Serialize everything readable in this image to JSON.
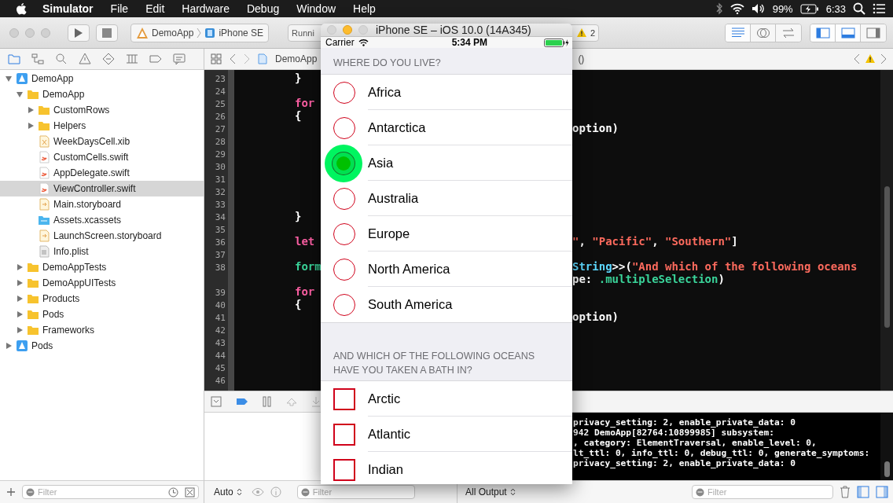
{
  "menu_bar": {
    "menus": [
      {
        "label": "Simulator",
        "kind": "app"
      },
      {
        "label": "File",
        "kind": "menu"
      },
      {
        "label": "Edit",
        "kind": "menu"
      },
      {
        "label": "Hardware",
        "kind": "menu"
      },
      {
        "label": "Debug",
        "kind": "menu"
      },
      {
        "label": "Window",
        "kind": "menu"
      },
      {
        "label": "Help",
        "kind": "menu"
      }
    ],
    "battery": "99%",
    "clock": "6:33"
  },
  "toolbar": {
    "scheme": "DemoApp",
    "destination": "iPhone SE",
    "activity": "Runni",
    "warning_count": "2",
    "editor_modes": [
      {
        "kind": "standard",
        "selected": true
      },
      {
        "kind": "assistant",
        "selected": false
      },
      {
        "kind": "version",
        "selected": false
      }
    ],
    "panels": [
      {
        "kind": "navigator",
        "on": true
      },
      {
        "kind": "debug",
        "on": true
      },
      {
        "kind": "utilities",
        "on": false
      }
    ]
  },
  "navigator": {
    "items": [
      {
        "label": "DemoApp",
        "kind": "project",
        "expanded": true,
        "selected": false,
        "children": [
          {
            "label": "DemoApp",
            "kind": "folder",
            "expanded": true,
            "selected": false,
            "children": [
              {
                "label": "CustomRows",
                "kind": "folder",
                "expanded": false,
                "selected": false
              },
              {
                "label": "Helpers",
                "kind": "folder",
                "expanded": false,
                "selected": false
              },
              {
                "label": "WeekDaysCell.xib",
                "kind": "xib",
                "selected": false
              },
              {
                "label": "CustomCells.swift",
                "kind": "swift",
                "selected": false
              },
              {
                "label": "AppDelegate.swift",
                "kind": "swift",
                "selected": false
              },
              {
                "label": "ViewController.swift",
                "kind": "swift",
                "selected": true
              },
              {
                "label": "Main.storyboard",
                "kind": "storyboard",
                "selected": false
              },
              {
                "label": "Assets.xcassets",
                "kind": "assets",
                "selected": false
              },
              {
                "label": "LaunchScreen.storyboard",
                "kind": "storyboard",
                "selected": false
              },
              {
                "label": "Info.plist",
                "kind": "plist",
                "selected": false
              }
            ]
          },
          {
            "label": "DemoAppTests",
            "kind": "folder",
            "expanded": false,
            "selected": false
          },
          {
            "label": "DemoAppUITests",
            "kind": "folder",
            "expanded": false,
            "selected": false
          },
          {
            "label": "Products",
            "kind": "folder",
            "expanded": false,
            "selected": false
          },
          {
            "label": "Pods",
            "kind": "folder",
            "expanded": false,
            "selected": false
          },
          {
            "label": "Frameworks",
            "kind": "folder",
            "expanded": false,
            "selected": false
          }
        ]
      },
      {
        "label": "Pods",
        "kind": "project",
        "expanded": false,
        "selected": false
      }
    ],
    "filter": {
      "placeholder": "Filter"
    }
  },
  "jump_bar": {
    "crumb": "DemoApp",
    "symbol": "()"
  },
  "editor": {
    "lines": [
      {
        "kind": "line",
        "number": "23",
        "left": [
          {
            "kind": "plain",
            "t": "}"
          }
        ]
      },
      {
        "kind": "line",
        "number": "24"
      },
      {
        "kind": "line",
        "number": "25",
        "left": [
          {
            "kind": "keyword",
            "t": "for"
          }
        ]
      },
      {
        "kind": "line",
        "number": "26",
        "left": [
          {
            "kind": "plain",
            "t": "{"
          }
        ]
      },
      {
        "kind": "line",
        "number": "27",
        "right": [
          {
            "kind": "plain",
            "t": "option)"
          }
        ]
      },
      {
        "kind": "line",
        "number": "28"
      },
      {
        "kind": "line",
        "number": "29"
      },
      {
        "kind": "line",
        "number": "30"
      },
      {
        "kind": "line",
        "number": "31"
      },
      {
        "kind": "line",
        "number": "32"
      },
      {
        "kind": "line",
        "number": "33"
      },
      {
        "kind": "line",
        "number": "34",
        "left": [
          {
            "kind": "plain",
            "t": "}"
          }
        ]
      },
      {
        "kind": "line",
        "number": "35"
      },
      {
        "kind": "line",
        "number": "36",
        "left": [
          {
            "kind": "keyword",
            "t": "let"
          }
        ],
        "right": [
          {
            "kind": "string",
            "t": "\""
          },
          {
            "kind": "plain",
            "t": ", "
          },
          {
            "kind": "string",
            "t": "\"Pacific\""
          },
          {
            "kind": "plain",
            "t": ", "
          },
          {
            "kind": "string",
            "t": "\"Southern\""
          },
          {
            "kind": "plain",
            "t": "]"
          }
        ]
      },
      {
        "kind": "line",
        "number": "37"
      },
      {
        "kind": "line",
        "number": "38",
        "left": [
          {
            "kind": "member",
            "t": "form"
          }
        ],
        "right": [
          {
            "kind": "type",
            "t": "String"
          },
          {
            "kind": "plain",
            "t": ">>("
          },
          {
            "kind": "string",
            "t": "\"And which of the following oceans"
          }
        ]
      },
      {
        "kind": "wrap",
        "right": [
          {
            "kind": "plain",
            "t": "pe: "
          },
          {
            "kind": "member",
            "t": ".multipleSelection"
          },
          {
            "kind": "plain",
            "t": ")"
          }
        ]
      },
      {
        "kind": "line",
        "number": "39",
        "left": [
          {
            "kind": "keyword",
            "t": "for"
          }
        ]
      },
      {
        "kind": "line",
        "number": "40",
        "left": [
          {
            "kind": "plain",
            "t": "{"
          }
        ]
      },
      {
        "kind": "line",
        "number": "41",
        "right": [
          {
            "kind": "plain",
            "t": "option)"
          }
        ]
      },
      {
        "kind": "line",
        "number": "42"
      },
      {
        "kind": "line",
        "number": "43"
      },
      {
        "kind": "line",
        "number": "44"
      },
      {
        "kind": "line",
        "number": "45"
      },
      {
        "kind": "line",
        "number": "46"
      }
    ]
  },
  "debug": {
    "scope": "Auto",
    "variables_filter": {
      "placeholder": "Filter"
    },
    "output": "All Output",
    "console_filter": {
      "placeholder": "Filter"
    },
    "console_lines": [
      "privacy_setting: 2, enable_private_data: 0",
      "942 DemoApp[82764:10899985] subsystem:",
      ", category: ElementTraversal, enable_level: 0,",
      "lt_ttl: 0, info_ttl: 0, debug_ttl: 0, generate_symptoms:",
      "privacy_setting: 2, enable_private_data: 0"
    ]
  },
  "simulator": {
    "title": "iPhone SE – iOS 10.0 (14A345)",
    "carrier": "Carrier",
    "time": "5:34 PM",
    "sections": [
      {
        "header": "WHERE DO YOU LIVE?",
        "kind": "radio",
        "options": [
          {
            "label": "Africa",
            "selected": false
          },
          {
            "label": "Antarctica",
            "selected": false
          },
          {
            "label": "Asia",
            "selected": true
          },
          {
            "label": "Australia",
            "selected": false
          },
          {
            "label": "Europe",
            "selected": false
          },
          {
            "label": "North America",
            "selected": false
          },
          {
            "label": "South America",
            "selected": false
          }
        ]
      },
      {
        "header": "AND WHICH OF THE FOLLOWING OCEANS HAVE YOU TAKEN A BATH IN?",
        "kind": "checkbox",
        "options": [
          {
            "label": "Arctic",
            "selected": false
          },
          {
            "label": "Atlantic",
            "selected": false
          },
          {
            "label": "Indian",
            "selected": false
          }
        ]
      }
    ]
  }
}
